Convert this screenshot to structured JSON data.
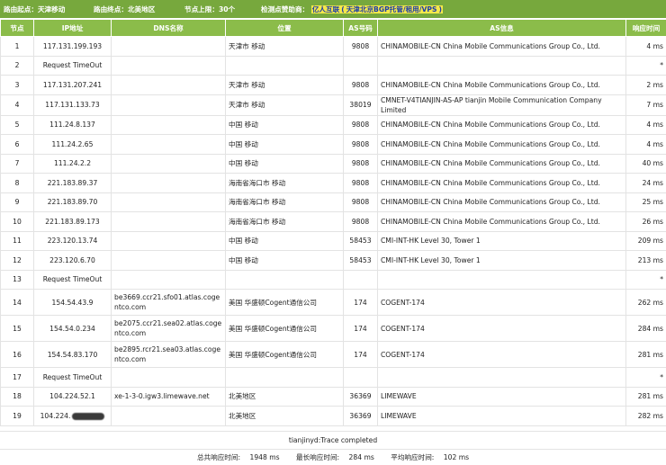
{
  "header": {
    "start_label": "路由起点：",
    "start_value": "天津移动",
    "end_label": "路由终点：",
    "end_value": "北美地区",
    "limit_label": "节点上限：",
    "limit_value": "30个",
    "sponsor_label": "检测点赞助商：",
    "sponsor_name": "亿人互联",
    "sponsor_link": "天津北京BGP托管/租用/VPS",
    "bg_color": "#77a83d",
    "highlight_color": "#f5e84a",
    "link_color": "#1a3da8"
  },
  "table": {
    "header_color": "#8bbc4a",
    "columns": [
      "节点",
      "IP地址",
      "DNS名称",
      "位置",
      "AS号码",
      "AS信息",
      "响应时间"
    ],
    "rows": [
      {
        "node": "1",
        "ip": "117.131.199.193",
        "dns": "",
        "location": "天津市 移动",
        "as": "9808",
        "asinfo": "CHINAMOBILE-CN China Mobile Communications Group Co., Ltd.",
        "time": "4 ms"
      },
      {
        "node": "2",
        "ip": "Request TimeOut",
        "dns": "",
        "location": "",
        "as": "",
        "asinfo": "",
        "time": "*"
      },
      {
        "node": "3",
        "ip": "117.131.207.241",
        "dns": "",
        "location": "天津市 移动",
        "as": "9808",
        "asinfo": "CHINAMOBILE-CN China Mobile Communications Group Co., Ltd.",
        "time": "2 ms"
      },
      {
        "node": "4",
        "ip": "117.131.133.73",
        "dns": "",
        "location": "天津市 移动",
        "as": "38019",
        "asinfo": "CMNET-V4TIANJIN-AS-AP tianjin Mobile Communication Company Limited",
        "time": "7 ms"
      },
      {
        "node": "5",
        "ip": "111.24.8.137",
        "dns": "",
        "location": "中国 移动",
        "as": "9808",
        "asinfo": "CHINAMOBILE-CN China Mobile Communications Group Co., Ltd.",
        "time": "4 ms"
      },
      {
        "node": "6",
        "ip": "111.24.2.65",
        "dns": "",
        "location": "中国 移动",
        "as": "9808",
        "asinfo": "CHINAMOBILE-CN China Mobile Communications Group Co., Ltd.",
        "time": "4 ms"
      },
      {
        "node": "7",
        "ip": "111.24.2.2",
        "dns": "",
        "location": "中国 移动",
        "as": "9808",
        "asinfo": "CHINAMOBILE-CN China Mobile Communications Group Co., Ltd.",
        "time": "40 ms"
      },
      {
        "node": "8",
        "ip": "221.183.89.37",
        "dns": "",
        "location": "海南省海口市 移动",
        "as": "9808",
        "asinfo": "CHINAMOBILE-CN China Mobile Communications Group Co., Ltd.",
        "time": "24 ms"
      },
      {
        "node": "9",
        "ip": "221.183.89.70",
        "dns": "",
        "location": "海南省海口市 移动",
        "as": "9808",
        "asinfo": "CHINAMOBILE-CN China Mobile Communications Group Co., Ltd.",
        "time": "25 ms"
      },
      {
        "node": "10",
        "ip": "221.183.89.173",
        "dns": "",
        "location": "海南省海口市 移动",
        "as": "9808",
        "asinfo": "CHINAMOBILE-CN China Mobile Communications Group Co., Ltd.",
        "time": "26 ms"
      },
      {
        "node": "11",
        "ip": "223.120.13.74",
        "dns": "",
        "location": "中国 移动",
        "as": "58453",
        "asinfo": "CMI-INT-HK Level 30, Tower 1",
        "time": "209 ms"
      },
      {
        "node": "12",
        "ip": "223.120.6.70",
        "dns": "",
        "location": "中国 移动",
        "as": "58453",
        "asinfo": "CMI-INT-HK Level 30, Tower 1",
        "time": "213 ms"
      },
      {
        "node": "13",
        "ip": "Request TimeOut",
        "dns": "",
        "location": "",
        "as": "",
        "asinfo": "",
        "time": "*"
      },
      {
        "node": "14",
        "ip": "154.54.43.9",
        "dns": "be3669.ccr21.sfo01.atlas.cogentco.com",
        "location": "美国 华盛顿Cogent通信公司",
        "as": "174",
        "asinfo": "COGENT-174",
        "time": "262 ms"
      },
      {
        "node": "15",
        "ip": "154.54.0.234",
        "dns": "be2075.ccr21.sea02.atlas.cogentco.com",
        "location": "美国 华盛顿Cogent通信公司",
        "as": "174",
        "asinfo": "COGENT-174",
        "time": "284 ms"
      },
      {
        "node": "16",
        "ip": "154.54.83.170",
        "dns": "be2895.rcr21.sea03.atlas.cogentco.com",
        "location": "美国 华盛顿Cogent通信公司",
        "as": "174",
        "asinfo": "COGENT-174",
        "time": "281 ms"
      },
      {
        "node": "17",
        "ip": "Request TimeOut",
        "dns": "",
        "location": "",
        "as": "",
        "asinfo": "",
        "time": "*"
      },
      {
        "node": "18",
        "ip": "104.224.52.1",
        "dns": "xe-1-3-0.igw3.limewave.net",
        "location": "北美地区",
        "as": "36369",
        "asinfo": "LIMEWAVE",
        "time": "281 ms"
      },
      {
        "node": "19",
        "ip": "104.224.",
        "dns": "",
        "location": "北美地区",
        "as": "36369",
        "asinfo": "LIMEWAVE",
        "time": "282 ms"
      }
    ]
  },
  "footer": {
    "complete_text": "tianjinyd:Trace completed",
    "total_label": "总共响应时间:",
    "total_value": "1948 ms",
    "max_label": "最长响应时间:",
    "max_value": "284 ms",
    "avg_label": "平均响应时间:",
    "avg_value": "102 ms"
  }
}
